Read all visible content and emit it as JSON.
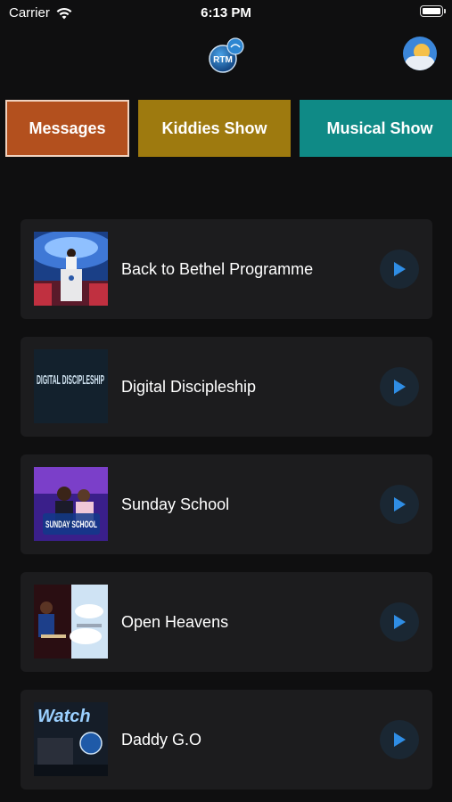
{
  "status_bar": {
    "carrier": "Carrier",
    "time": "6:13 PM"
  },
  "header": {
    "logo_text": "RTM"
  },
  "tabs": [
    {
      "label": "Messages",
      "color": "#b3501e",
      "selected": true
    },
    {
      "label": "Kiddies Show",
      "color": "#9e7a0f",
      "selected": false
    },
    {
      "label": "Musical Show",
      "color": "#0f8a86",
      "selected": false
    }
  ],
  "items": [
    {
      "title": "Back to Bethel Programme"
    },
    {
      "title": "Digital Discipleship",
      "thumb_text": "DIGITAL DISCIPLESHIP"
    },
    {
      "title": "Sunday School",
      "thumb_text": "SUNDAY SCHOOL"
    },
    {
      "title": "Open Heavens"
    },
    {
      "title": "Daddy G.O",
      "thumb_text": "Watch"
    }
  ],
  "colors": {
    "background": "#0f0f10",
    "card": "#1c1c1e",
    "play_button": "#1a2733",
    "play_icon": "#2f8de4"
  },
  "icons": [
    "wifi-icon",
    "rtm-logo-icon",
    "profile-weather-icon",
    "play-icon"
  ]
}
